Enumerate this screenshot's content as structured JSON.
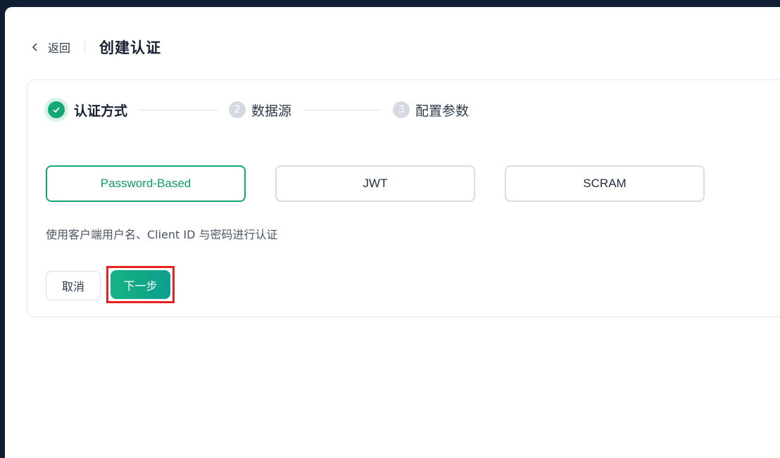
{
  "header": {
    "back_label": "返回",
    "title": "创建认证"
  },
  "steps": [
    {
      "label": "认证方式",
      "state": "done"
    },
    {
      "number": "2",
      "label": "数据源",
      "state": "pending"
    },
    {
      "number": "3",
      "label": "配置参数",
      "state": "pending"
    }
  ],
  "auth_options": [
    {
      "label": "Password-Based",
      "selected": true
    },
    {
      "label": "JWT",
      "selected": false
    },
    {
      "label": "SCRAM",
      "selected": false
    }
  ],
  "description": "使用客户端用户名、Client ID 与密码进行认证",
  "actions": {
    "cancel_label": "取消",
    "next_label": "下一步"
  },
  "colors": {
    "accent": "#13a773",
    "highlight_border": "#e8231f",
    "background": "#0f1e33"
  },
  "icons": {
    "back": "chevron-left-icon",
    "step_done": "check-circle-icon"
  }
}
